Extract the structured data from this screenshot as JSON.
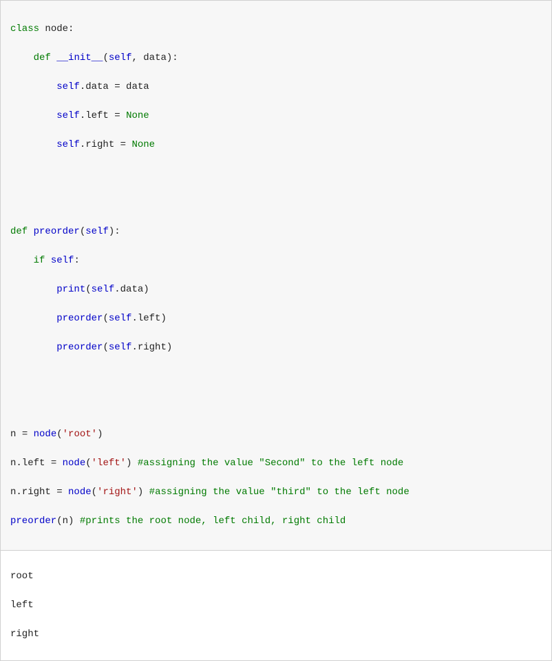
{
  "code": {
    "l1": {
      "kw": "class",
      "sp1": " ",
      "id1": "node:"
    },
    "l2": {
      "indent": "    ",
      "kw": "def",
      "sp": " ",
      "fn": "__init__",
      "paren": "(",
      "self": "self",
      "rest": ", data):"
    },
    "l3": {
      "indent": "        ",
      "self": "self",
      "dot": ".data ",
      "op": "=",
      "rest": " data"
    },
    "l4": {
      "indent": "        ",
      "self": "self",
      "dot": ".left ",
      "op": "=",
      "sp": " ",
      "kw": "None"
    },
    "l5": {
      "indent": "        ",
      "self": "self",
      "dot": ".right ",
      "op": "=",
      "sp": " ",
      "kw": "None"
    },
    "l8": {
      "kw": "def",
      "sp": " ",
      "fn": "preorder",
      "paren": "(",
      "self": "self",
      "rest": "):"
    },
    "l9": {
      "indent": "    ",
      "kw": "if",
      "sp": " ",
      "self": "self",
      "rest": ":"
    },
    "l10": {
      "indent": "        ",
      "fn": "print",
      "paren": "(",
      "self": "self",
      "rest": ".data)"
    },
    "l11": {
      "indent": "        ",
      "fn": "preorder",
      "paren": "(",
      "self": "self",
      "rest": ".left)"
    },
    "l12": {
      "indent": "        ",
      "fn": "preorder",
      "paren": "(",
      "self": "self",
      "rest": ".right)"
    },
    "l15": {
      "id1": "n ",
      "op": "=",
      "sp": " ",
      "fn": "node",
      "paren": "(",
      "str": "'root'",
      "rest": ")"
    },
    "l16": {
      "id1": "n.left ",
      "op": "=",
      "sp": " ",
      "fn": "node",
      "paren": "(",
      "str": "'left'",
      "rest": ")",
      "sp2": " ",
      "cm": "#assigning the value \"Second\" to the left node"
    },
    "l17": {
      "id1": "n.right ",
      "op": "=",
      "sp": " ",
      "fn": "node",
      "paren": "(",
      "str": "'right'",
      "rest": ")",
      "sp2": " ",
      "cm": "#assigning the value \"third\" to the left node"
    },
    "l18": {
      "fn": "preorder",
      "paren": "(n)",
      "sp": " ",
      "cm": "#prints the root node, left child, right child"
    }
  },
  "output": {
    "o1": "root",
    "o2": "left",
    "o3": "right"
  }
}
